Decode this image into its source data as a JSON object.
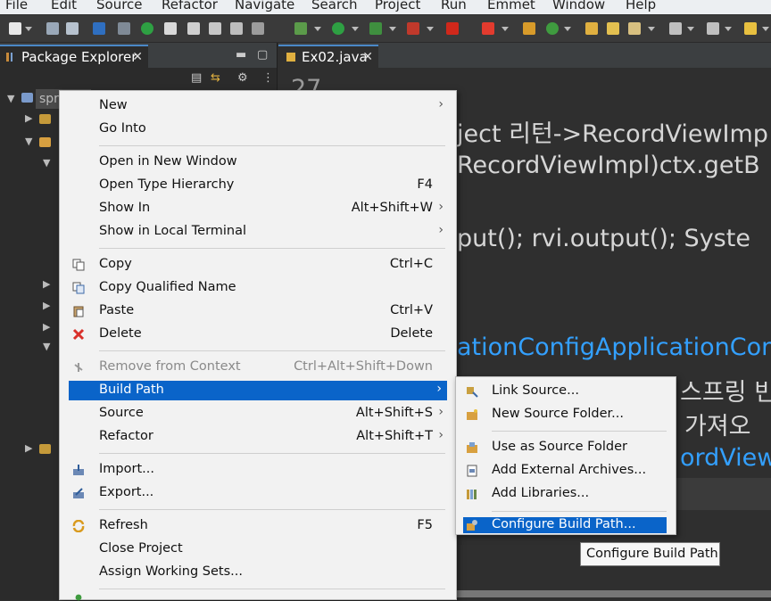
{
  "menubar": [
    "File",
    "Edit",
    "Source",
    "Refactor",
    "Navigate",
    "Search",
    "Project",
    "Run",
    "Emmet",
    "Window",
    "Help"
  ],
  "package_explorer": {
    "tab_title": "Package Explorer",
    "project_label": "spr"
  },
  "editor": {
    "tab_title": "Ex02.java",
    "lines": [
      {
        "text": "27",
        "color": "#d6d6d6"
      },
      {
        "text": "ject 리턴->RecordViewImp",
        "color": "#d6d6d6"
      },
      {
        "text": "RecordViewImpl)ctx.getB",
        "color": "#d6d6d6"
      },
      {
        "text": "put(); rvi.output(); Syste",
        "color": "#d6d6d6"
      },
      {
        "text": "ationConfigApplicationCon",
        "color": "#33a0ff"
      },
      {
        "text": "스프링 빈",
        "color": "#d6d6d6"
      },
      {
        "text": "가져오",
        "color": "#d6d6d6"
      },
      {
        "text": "ordView",
        "color": "#33a0ff"
      }
    ]
  },
  "context_menu": {
    "items": [
      {
        "label": "New",
        "shortcut": "",
        "submenu": true
      },
      {
        "label": "Go Into",
        "shortcut": ""
      },
      {
        "label": "Open in New Window",
        "shortcut": ""
      },
      {
        "label": "Open Type Hierarchy",
        "shortcut": "F4"
      },
      {
        "label": "Show In",
        "shortcut": "Alt+Shift+W",
        "submenu": true
      },
      {
        "label": "Show in Local Terminal",
        "shortcut": "",
        "submenu": true
      },
      {
        "label": "Copy",
        "shortcut": "Ctrl+C",
        "icon": "copy-icon"
      },
      {
        "label": "Copy Qualified Name",
        "shortcut": "",
        "icon": "copy-qualified-name-icon"
      },
      {
        "label": "Paste",
        "shortcut": "Ctrl+V",
        "icon": "paste-icon"
      },
      {
        "label": "Delete",
        "shortcut": "Delete",
        "icon": "delete-icon"
      },
      {
        "label": "Remove from Context",
        "shortcut": "Ctrl+Alt+Shift+Down",
        "disabled": true
      },
      {
        "label": "Build Path",
        "shortcut": "",
        "submenu": true,
        "highlighted": true
      },
      {
        "label": "Source",
        "shortcut": "Alt+Shift+S",
        "submenu": true
      },
      {
        "label": "Refactor",
        "shortcut": "Alt+Shift+T",
        "submenu": true
      },
      {
        "label": "Import...",
        "shortcut": "",
        "icon": "import-icon"
      },
      {
        "label": "Export...",
        "shortcut": "",
        "icon": "export-icon"
      },
      {
        "label": "Refresh",
        "shortcut": "F5",
        "icon": "refresh-icon"
      },
      {
        "label": "Close Project",
        "shortcut": ""
      },
      {
        "label": "Assign Working Sets...",
        "shortcut": ""
      }
    ]
  },
  "build_path_submenu": {
    "items": [
      {
        "label": "Link Source...",
        "icon": "link-source-icon"
      },
      {
        "label": "New Source Folder...",
        "icon": "new-source-folder-icon"
      },
      {
        "label": "Use as Source Folder",
        "icon": "use-as-source-folder-icon"
      },
      {
        "label": "Add External Archives...",
        "icon": "add-external-archives-icon"
      },
      {
        "label": "Add Libraries...",
        "icon": "add-libraries-icon"
      },
      {
        "label": "Configure Build Path...",
        "icon": "configure-build-path-icon",
        "highlighted": true
      }
    ]
  },
  "tooltip": {
    "text": "Configure Build Path"
  },
  "colors": {
    "menu_highlight": "#0a64c9",
    "editor_background": "#2f2f2f",
    "code_blue": "#33a0ff",
    "tab_accent": "#4a88c7"
  }
}
